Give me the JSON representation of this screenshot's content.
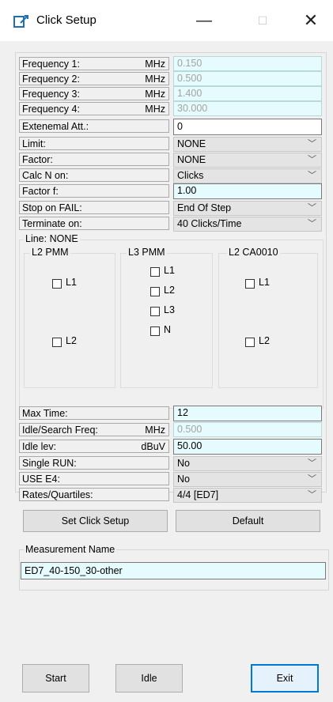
{
  "window": {
    "title": "Click Setup",
    "minimize_glyph": "—",
    "maximize_glyph": "☐",
    "close_glyph": "✕"
  },
  "icons": {
    "app": "click-setup-app-icon",
    "dropdown": "chevron-down-icon",
    "checkbox": "checkbox-icon"
  },
  "colors": {
    "field_cyan": "#e6fbfd",
    "window_bg": "#f0f0f0",
    "accent": "#0078d7"
  },
  "params": {
    "freq1": {
      "label": "Frequency 1:",
      "unit": "MHz",
      "value": "0.150"
    },
    "freq2": {
      "label": "Frequency 2:",
      "unit": "MHz",
      "value": "0.500"
    },
    "freq3": {
      "label": "Frequency 3:",
      "unit": "MHz",
      "value": "1.400"
    },
    "freq4": {
      "label": "Frequency 4:",
      "unit": "MHz",
      "value": "30.000"
    },
    "ext_att": {
      "label": "Extenemal Att.:",
      "value": "0"
    },
    "limit": {
      "label": "Limit:",
      "value": "NONE"
    },
    "factor": {
      "label": "Factor:",
      "value": "NONE"
    },
    "calc_n": {
      "label": "Calc N on:",
      "value": "Clicks"
    },
    "factor_f": {
      "label": "Factor f:",
      "value": "1.00"
    },
    "stop_fail": {
      "label": "Stop on FAIL:",
      "value": "End Of Step"
    },
    "terminate": {
      "label": "Terminate on:",
      "value": "40 Clicks/Time"
    }
  },
  "line": {
    "title": "Line: NONE",
    "l2pmm": {
      "title": "L2 PMM",
      "l1": "L1",
      "l2": "L2"
    },
    "l3pmm": {
      "title": "L3 PMM",
      "l1": "L1",
      "l2": "L2",
      "l3": "L3",
      "n": "N"
    },
    "l2ca": {
      "title": "L2 CA0010",
      "l1": "L1",
      "l2": "L2"
    }
  },
  "params2": {
    "max_time": {
      "label": "Max Time:",
      "value": "12"
    },
    "idle_freq": {
      "label": "Idle/Search Freq:",
      "unit": "MHz",
      "value": "0.500"
    },
    "idle_lev": {
      "label": "Idle lev:",
      "unit": "dBuV",
      "value": "50.00"
    },
    "single_run": {
      "label": "Single RUN:",
      "value": "No"
    },
    "use_e4": {
      "label": "USE E4:",
      "value": "No"
    },
    "rates": {
      "label": "Rates/Quartiles:",
      "value": "4/4 [ED7]"
    }
  },
  "buttons": {
    "set_setup": "Set Click Setup",
    "default": "Default",
    "start": "Start",
    "idle": "Idle",
    "exit": "Exit"
  },
  "measurement": {
    "title": "Measurement Name",
    "value": "ED7_40-150_30-other"
  }
}
